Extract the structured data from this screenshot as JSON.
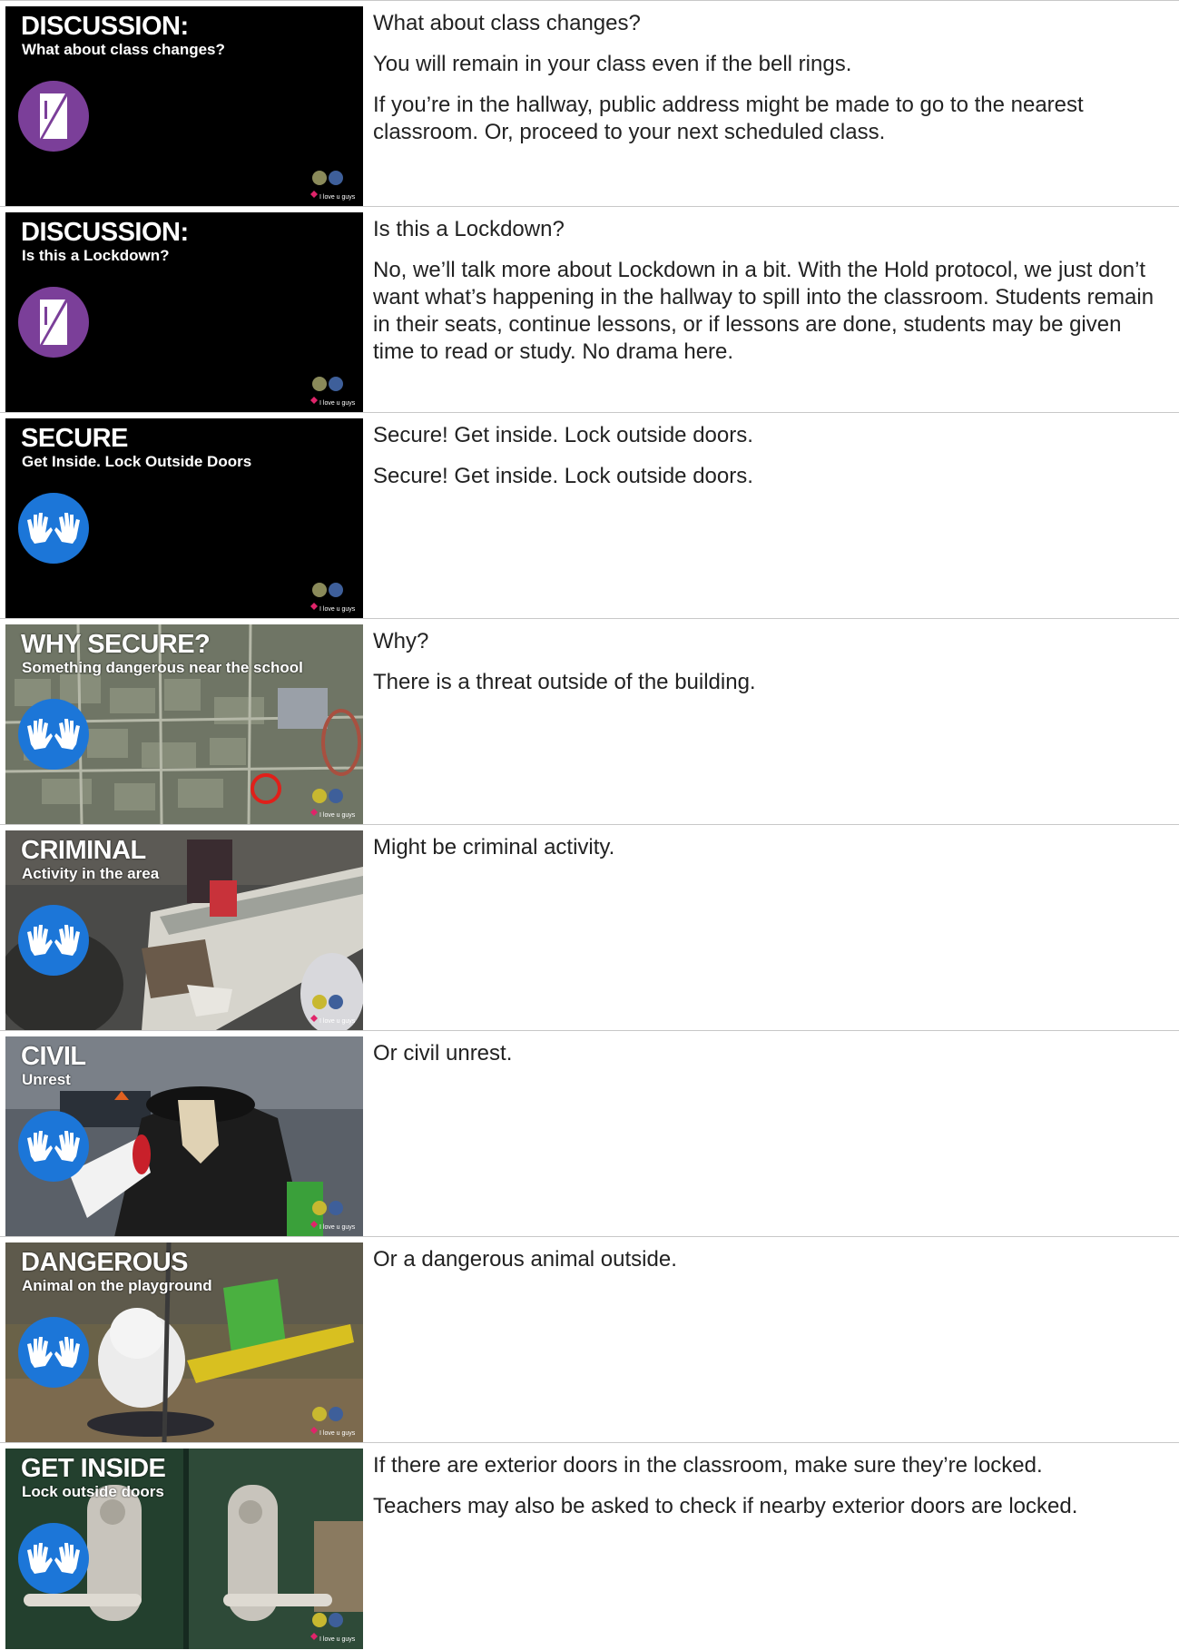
{
  "icons": {
    "hold": "hold-door-icon",
    "secure": "secure-hands-icon",
    "logo": "i-love-u-guys-logo"
  },
  "colors": {
    "hold_purple": "#7b3f99",
    "secure_blue": "#1c76d8",
    "slide_black": "#000000",
    "text": "#222222",
    "divider": "#c8c8c8"
  },
  "logo_text": "I love u guys",
  "rows": [
    {
      "slide": {
        "title": "DISCUSSION:",
        "subtitle": "What about class changes?",
        "protocol": "hold",
        "background": "black"
      },
      "notes": [
        "What about class changes?",
        "You will remain in your class even if the bell rings.",
        "If you’re in the hallway, public address might be made to go to the nearest classroom. Or, proceed to your next scheduled class."
      ]
    },
    {
      "slide": {
        "title": "DISCUSSION:",
        "subtitle": "Is this a Lockdown?",
        "protocol": "hold",
        "background": "black"
      },
      "notes": [
        "Is this a Lockdown?",
        "No, we’ll talk more about Lockdown in a bit. With the Hold protocol, we just don’t want what’s happening in the hallway to spill into the classroom. Students remain in their seats, continue lessons, or if lessons are done, students may be given time to read or study. No drama here."
      ]
    },
    {
      "slide": {
        "title": "SECURE",
        "subtitle": "Get Inside. Lock Outside Doors",
        "protocol": "secure",
        "background": "black"
      },
      "notes": [
        "Secure! Get inside. Lock outside doors.",
        "Secure! Get inside. Lock outside doors."
      ]
    },
    {
      "slide": {
        "title": "WHY SECURE?",
        "subtitle": "Something dangerous near the school",
        "protocol": "secure",
        "background": "aerial-map"
      },
      "notes": [
        "Why?",
        "There is a threat outside of the building."
      ]
    },
    {
      "slide": {
        "title": "CRIMINAL",
        "subtitle": "Activity in the area",
        "protocol": "secure",
        "background": "store-robbery-photo"
      },
      "notes": [
        "Might be criminal activity."
      ]
    },
    {
      "slide": {
        "title": "CIVIL",
        "subtitle": "Unrest",
        "protocol": "secure",
        "background": "protest-photo"
      },
      "notes": [
        "Or civil unrest."
      ]
    },
    {
      "slide": {
        "title": "DANGEROUS",
        "subtitle": "Animal on the playground",
        "protocol": "secure",
        "background": "dog-playground-photo"
      },
      "notes": [
        "Or a dangerous animal outside."
      ]
    },
    {
      "slide": {
        "title": "GET INSIDE",
        "subtitle": "Lock outside doors",
        "protocol": "secure",
        "background": "door-handles-photo"
      },
      "notes": [
        "If there are exterior doors in the classroom, make sure they’re locked.",
        "Teachers may also be asked to check if nearby exterior doors are locked."
      ]
    }
  ]
}
